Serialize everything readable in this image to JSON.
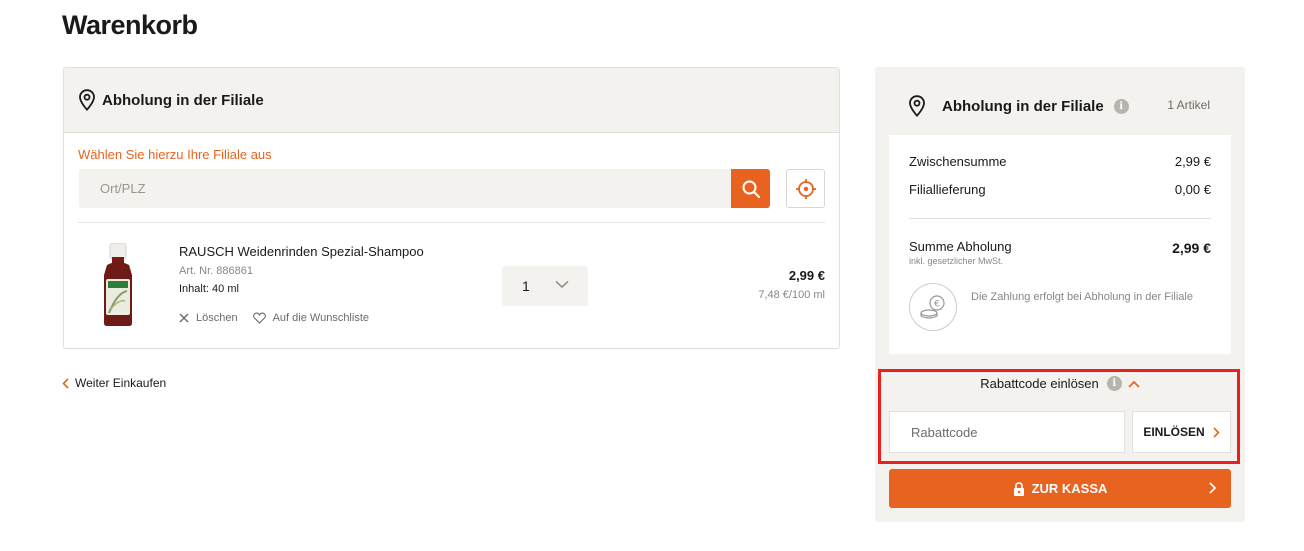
{
  "page": {
    "title": "Warenkorb"
  },
  "pickup": {
    "header_title": "Abholung in der Filiale",
    "select_hint": "Wählen Sie hierzu Ihre Filiale aus",
    "search_placeholder": "Ort/PLZ",
    "icons": {
      "location": "map-pin-icon",
      "search": "search-icon",
      "locate": "crosshair-icon"
    }
  },
  "cart_item": {
    "name": "RAUSCH Weidenrinden Spezial-Shampoo",
    "article_no": "Art. Nr. 886861",
    "content": "Inhalt: 40 ml",
    "delete_label": "Löschen",
    "wishlist_label": "Auf die Wunschliste",
    "quantity": "1",
    "price": "2,99 €",
    "unit_price": "7,48 €/100 ml"
  },
  "continue_label": "Weiter Einkaufen",
  "summary": {
    "header_title": "Abholung in der Filiale",
    "info_glyph": "i",
    "item_count": "1 Artikel",
    "subtotal_label": "Zwischensumme",
    "subtotal_value": "2,99 €",
    "delivery_label": "Filiallieferung",
    "delivery_value": "0,00 €",
    "total_label": "Summe Abholung",
    "total_sub": "inkl. gesetzlicher MwSt.",
    "total_value": "2,99 €",
    "payment_note": "Die Zahlung erfolgt bei Abholung in der Filiale"
  },
  "coupon": {
    "toggle_label": "Rabattcode einlösen",
    "input_placeholder": "Rabattcode",
    "redeem_label": "EINLÖSEN"
  },
  "checkout": {
    "label": "ZUR KASSA"
  },
  "colors": {
    "accent": "#e8631f",
    "highlight": "#e8211f",
    "panel": "#f4f2ef"
  }
}
